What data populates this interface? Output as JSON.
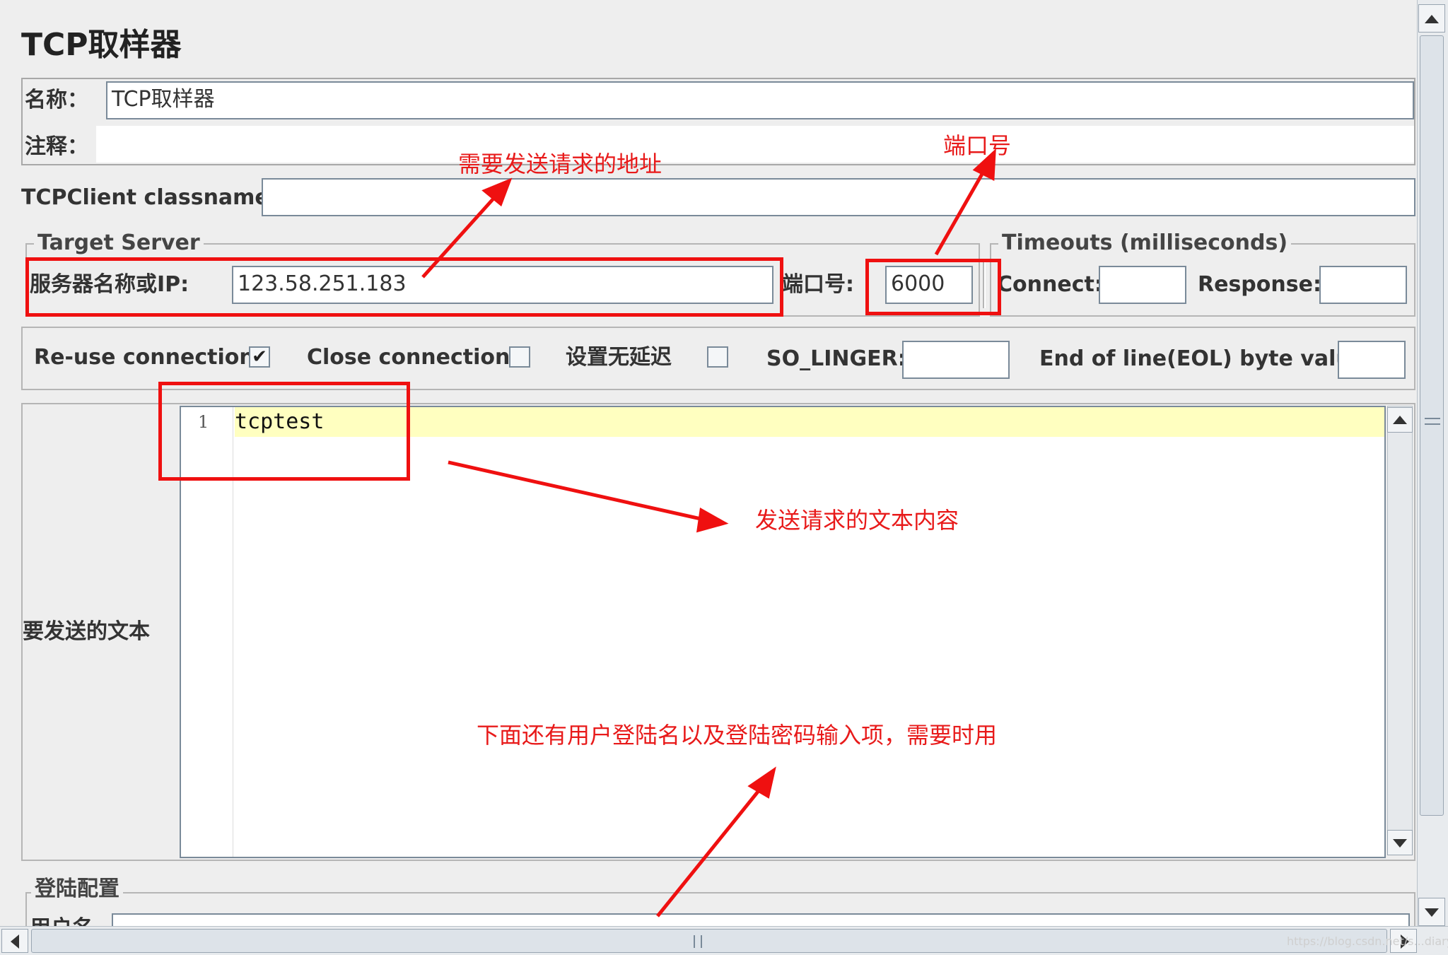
{
  "panel_title": "TCP取样器",
  "name_field": {
    "label": "名称：",
    "value": "TCP取样器"
  },
  "comment_field": {
    "label": "注释：",
    "value": ""
  },
  "classname_field": {
    "label": "TCPClient classname:",
    "value": ""
  },
  "target_server": {
    "legend": "Target Server",
    "server_label": "服务器名称或IP:",
    "server_value": "123.58.251.183",
    "port_label": "端口号:",
    "port_value": "6000"
  },
  "timeouts": {
    "legend": "Timeouts (milliseconds)",
    "connect_label": "Connect:",
    "connect_value": "",
    "response_label": "Response:",
    "response_value": ""
  },
  "options": {
    "reuse_label": "Re-use connection",
    "reuse_checked": true,
    "reuse_mark": "✔",
    "close_label": "Close connection",
    "close_checked": false,
    "nodelay_label": "设置无延迟",
    "nodelay_checked": false,
    "so_linger_label": "SO_LINGER:",
    "so_linger_value": "",
    "eol_label": "End of line(EOL) byte value:",
    "eol_value": ""
  },
  "text_to_send": {
    "label": "要发送的文本",
    "line_number": "1",
    "content": "tcptest"
  },
  "login_config": {
    "legend": "登陆配置",
    "user_label": "用户名"
  },
  "annotations": {
    "address_note": "需要发送请求的地址",
    "port_note": "端口号",
    "text_note": "发送请求的文本内容",
    "login_note": "下面还有用户登陆名以及登陆密码输入项，需要时用"
  },
  "watermark": "https://blog.csdn.net/s...diary",
  "colors": {
    "annotation_red": "#ef1010",
    "editor_highlight": "#ffffc0"
  }
}
